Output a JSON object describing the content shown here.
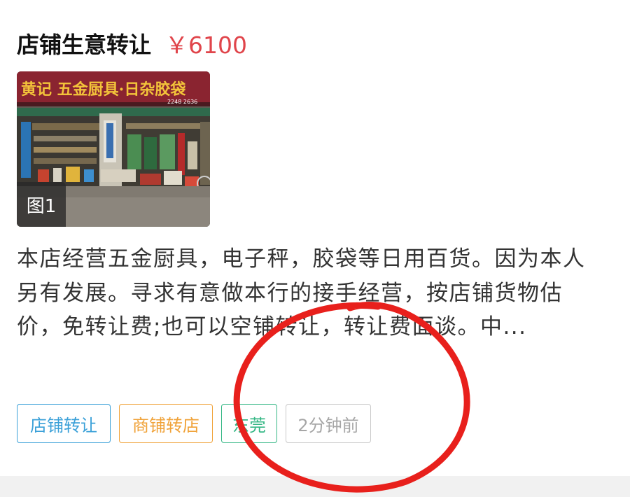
{
  "listing": {
    "title": "店铺生意转让",
    "price": "￥6100",
    "image_badge": "图1",
    "description": "本店经营五金厨具，电子秤，胶袋等日用百货。因为本人另有发展。寻求有意做本行的接手经营，按店铺货物估价，免转让费;也可以空铺转让，转让费面谈。中...",
    "shop_sign": "黄记 五金厨具·日杂胶袋",
    "shop_phone": "2248 2636"
  },
  "tags": [
    {
      "label": "店铺转让",
      "color": "#3aa0d8"
    },
    {
      "label": "商铺转店",
      "color": "#f0a238"
    },
    {
      "label": "东莞",
      "color": "#35b785"
    },
    {
      "label": "2分钟前",
      "color": "#a6a6a6"
    }
  ],
  "colors": {
    "price": "#e0454b",
    "annotation_circle": "#e8201c"
  }
}
